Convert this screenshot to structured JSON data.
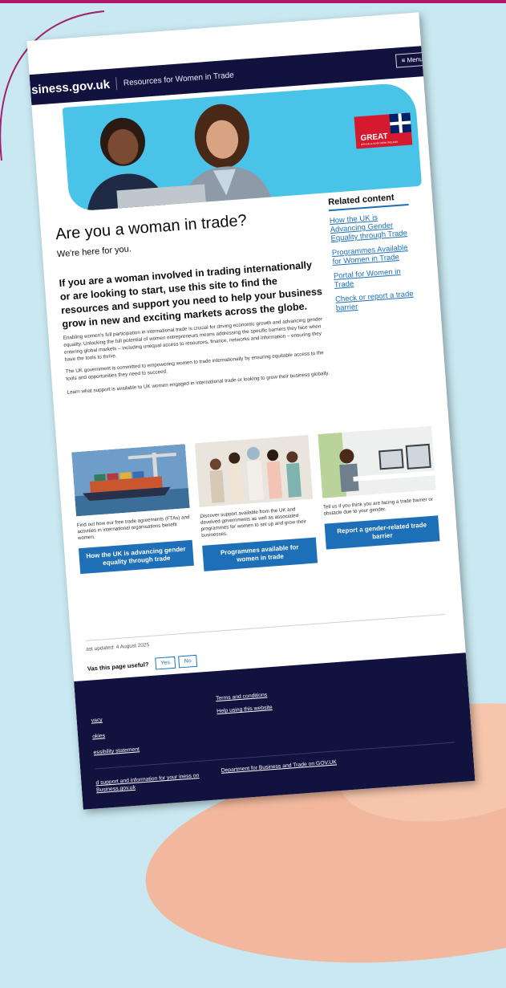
{
  "colors": {
    "navy": "#12123f",
    "link_blue": "#1d70b8",
    "hero_blue": "#49c4e8",
    "background": "#c9e8f1"
  },
  "header": {
    "logo": "usiness.gov.uk",
    "service": "Resources for Women in Trade",
    "menu": "≡ Menu"
  },
  "hero": {
    "badge": "GREAT",
    "badge_sub": "BRITAIN & NORTHERN IRELAND"
  },
  "main": {
    "title": "Are you a woman in trade?",
    "tagline": "We're here for you.",
    "lede": "If you are a woman involved in trading internationally or are looking to start, use this site to find the resources and support you need to help your business grow in new and exciting markets across the globe.",
    "paragraphs": [
      "Enabling women's full participation in international trade is crucial for driving economic growth and advancing gender equality. Unlocking the full potential of women entrepreneurs means addressing the specific barriers they face when entering global markets – including unequal access to resources, finance, networks and information – ensuring they have the tools to thrive.",
      "The UK government is committed to empowering women to trade internationally by ensuring equitable access to the tools and opportunities they need to succeed.",
      "Learn what support is available to UK women engaged in international trade or looking to grow their business globally."
    ]
  },
  "related": {
    "title": "Related content",
    "links": [
      "How the UK is Advancing Gender Equality through Trade",
      "Programmes Available for Women in Trade",
      "Portal for Women in Trade",
      "Check or report a trade barrier"
    ]
  },
  "cards": [
    {
      "image": "cargo-ship-image",
      "text": "Find out how our free trade agreements (FTAs) and activities in international organisations benefit women.",
      "button": "How the UK is advancing gender equality through trade"
    },
    {
      "image": "group-of-women-image",
      "text": "Discover support available from the UK and devolved governments as well as associated programmes for women to set up and grow their businesses.",
      "button": "Programmes available for women in trade"
    },
    {
      "image": "woman-at-computer-image",
      "text": "Tell us if you think you are facing a trade barrier or obstacle due to your gender.",
      "button": "Report a gender-related trade barrier"
    }
  ],
  "feedback": {
    "last_updated": "ast updated: 4 August 2025",
    "question": "Vas this page useful?",
    "yes": "Yes",
    "no": "No"
  },
  "footer": {
    "links_left": [
      "vacy",
      "okies",
      "essibility statement"
    ],
    "links_right": [
      "Terms and conditions",
      "Help using this website"
    ],
    "bottom_left": "d support and information for your iness on Business.gov.uk",
    "bottom_right": "Department for Business and Trade on GOV.UK"
  }
}
